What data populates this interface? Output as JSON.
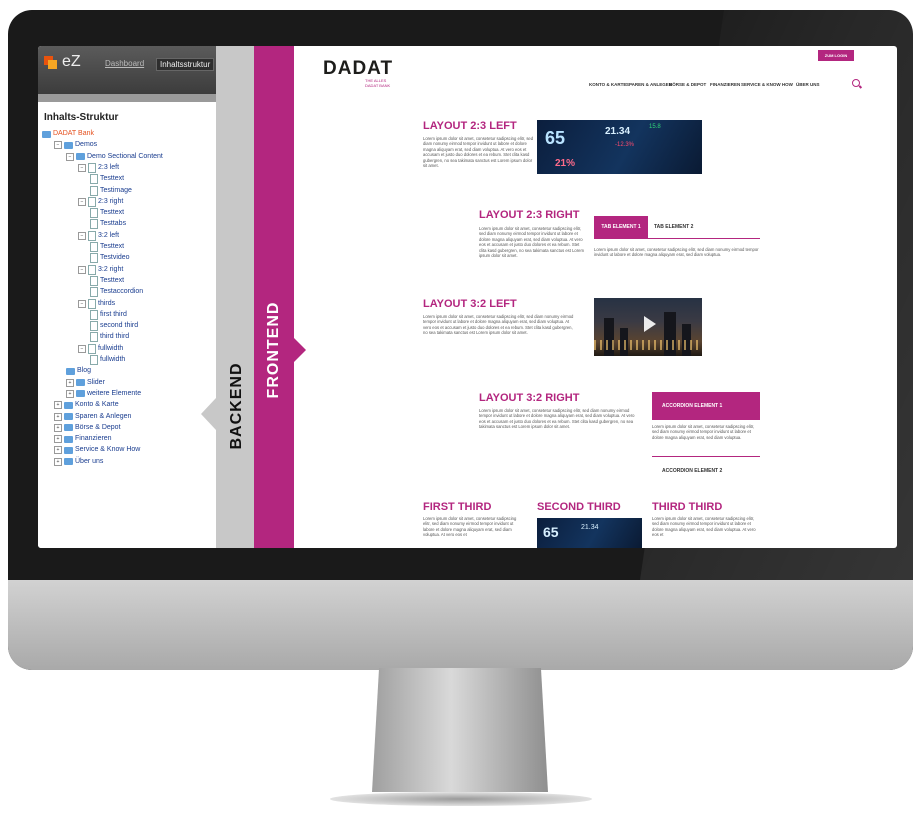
{
  "backend": {
    "logo_text": "eZ",
    "nav": {
      "dashboard": "Dashboard",
      "structure": "Inhaltsstruktur"
    },
    "tree_title": "Inhalts-Struktur",
    "tree": [
      {
        "label": "DADAT Bank",
        "depth": 0,
        "kind": "root",
        "toggle": ""
      },
      {
        "label": "Demos",
        "depth": 1,
        "kind": "folder",
        "toggle": "−"
      },
      {
        "label": "Demo Sectional Content",
        "depth": 2,
        "kind": "folder",
        "toggle": "−"
      },
      {
        "label": "2:3 left",
        "depth": 3,
        "kind": "page",
        "toggle": "−"
      },
      {
        "label": "Testtext",
        "depth": 4,
        "kind": "page",
        "toggle": ""
      },
      {
        "label": "Testimage",
        "depth": 4,
        "kind": "page",
        "toggle": ""
      },
      {
        "label": "2:3 right",
        "depth": 3,
        "kind": "page",
        "toggle": "−"
      },
      {
        "label": "Testtext",
        "depth": 4,
        "kind": "page",
        "toggle": ""
      },
      {
        "label": "Testtabs",
        "depth": 4,
        "kind": "page",
        "toggle": ""
      },
      {
        "label": "3:2 left",
        "depth": 3,
        "kind": "page",
        "toggle": "−"
      },
      {
        "label": "Testtext",
        "depth": 4,
        "kind": "page",
        "toggle": ""
      },
      {
        "label": "Testvideo",
        "depth": 4,
        "kind": "page",
        "toggle": ""
      },
      {
        "label": "3:2 right",
        "depth": 3,
        "kind": "page",
        "toggle": "−"
      },
      {
        "label": "Testtext",
        "depth": 4,
        "kind": "page",
        "toggle": ""
      },
      {
        "label": "Testaccordion",
        "depth": 4,
        "kind": "page",
        "toggle": ""
      },
      {
        "label": "thirds",
        "depth": 3,
        "kind": "page",
        "toggle": "−"
      },
      {
        "label": "first third",
        "depth": 4,
        "kind": "page",
        "toggle": ""
      },
      {
        "label": "second third",
        "depth": 4,
        "kind": "page",
        "toggle": ""
      },
      {
        "label": "third third",
        "depth": 4,
        "kind": "page",
        "toggle": ""
      },
      {
        "label": "fullwidth",
        "depth": 3,
        "kind": "page",
        "toggle": "−"
      },
      {
        "label": "fullwidth",
        "depth": 4,
        "kind": "page",
        "toggle": ""
      },
      {
        "label": "Blog",
        "depth": 2,
        "kind": "folder",
        "toggle": ""
      },
      {
        "label": "Slider",
        "depth": 2,
        "kind": "folder",
        "toggle": "+"
      },
      {
        "label": "weitere Elemente",
        "depth": 2,
        "kind": "folder",
        "toggle": "+"
      },
      {
        "label": "Konto & Karte",
        "depth": 1,
        "kind": "folder",
        "toggle": "+"
      },
      {
        "label": "Sparen & Anlegen",
        "depth": 1,
        "kind": "folder",
        "toggle": "+"
      },
      {
        "label": "Börse & Depot",
        "depth": 1,
        "kind": "folder",
        "toggle": "+"
      },
      {
        "label": "Finanzieren",
        "depth": 1,
        "kind": "folder",
        "toggle": "+"
      },
      {
        "label": "Service & Know How",
        "depth": 1,
        "kind": "folder",
        "toggle": "+"
      },
      {
        "label": "Über uns",
        "depth": 1,
        "kind": "folder",
        "toggle": "+"
      }
    ]
  },
  "labels": {
    "backend": "BACKEND",
    "frontend": "FRONTEND"
  },
  "frontend": {
    "logo": "DADAT",
    "logo_tagline": "THE ALLES\nDADAT BANK",
    "login": "ZUM LOGIN",
    "nav": [
      "KONTO & KARTE",
      "SPAREN & ANLEGEN",
      "BÖRSE & DEPOT",
      "FINANZIEREN",
      "SERVICE & KNOW HOW",
      "ÜBER UNS"
    ],
    "sections": {
      "l23": {
        "title": "LAYOUT 2:3 LEFT",
        "body": "Lorem ipsum dolor sit amet, consetetur sadipscing elitr, sed diam nonumy eirmod tempor invidunt ut labore et dolore magna aliquyam erat, sed diam voluptua. At vero eos et accusam et justo duo dolores et ea rebum. Stet clita kasd gubergren, no sea takimata sanctus est Lorem ipsum dolor sit amet."
      },
      "r23": {
        "title": "LAYOUT 2:3 RIGHT",
        "body": "Lorem ipsum dolor sit amet, consetetur sadipscing elitr, sed diam nonumy eirmod tempor invidunt ut labore et dolore magna aliquyam erat, sed diam voluptua. At vero eos et accusam et justo duo dolores et ea rebum. Stet clita kasd gubergren, no sea takimata sanctus est Lorem ipsum dolor sit amet.",
        "tab1": "TAB ELEMENT 1",
        "tab2": "TAB ELEMENT 2",
        "tab_body": "Lorem ipsum dolor sit amet, consetetur sadipscing elitr, sed diam nonumy eirmod tempor invidunt ut labore et dolore magna aliquyam erat, sed diam voluptua."
      },
      "l32": {
        "title": "LAYOUT 3:2 LEFT",
        "body": "Lorem ipsum dolor sit amet, consetetur sadipscing elitr, sed diam nonumy eirmod tempor invidunt ut labore et dolore magna aliquyam erat, sed diam voluptua. At vero eos et accusam et justo duo dolores et ea rebum. Stet clita kasd gubergren, no sea takimata sanctus est Lorem ipsum dolor sit amet."
      },
      "r32": {
        "title": "LAYOUT 3:2 RIGHT",
        "body": "Lorem ipsum dolor sit amet, consetetur sadipscing elitr, sed diam nonumy eirmod tempor invidunt ut labore et dolore magna aliquyam erat, sed diam voluptua. At vero eos et accusam et justo duo dolores et ea rebum. Stet clita kasd gubergren, no sea takimata sanctus est Lorem ipsum dolor sit amet.",
        "acc1": "ACCORDION ELEMENT 1",
        "acc1_body": "Lorem ipsum dolor sit amet, consetetur sadipscing elitr, sed diam nonumy eirmod tempor invidunt ut labore et dolore magna aliquyam erat, sed diam voluptua.",
        "acc2": "ACCORDION ELEMENT 2"
      },
      "thirds": [
        {
          "title": "FIRST THIRD",
          "body": "Lorem ipsum dolor sit amet, consetetur sadipscing elitr, sed diam nonumy eirmod tempor invidunt ut labore et dolore magna aliquyam erat, sed diam voluptua. At vero eos et"
        },
        {
          "title": "SECOND THIRD"
        },
        {
          "title": "THIRD THIRD",
          "body": "Lorem ipsum dolor sit amet, consetetur sadipscing elitr, sed diam nonumy eirmod tempor invidunt ut labore et dolore magna aliquyam erat, sed diam voluptua. At vero eos et"
        }
      ]
    },
    "ticker": {
      "big": "65",
      "mid": "21.34",
      "small": "15.8",
      "pct": "-12.3%",
      "pct2": "21%"
    }
  },
  "icons": [
    "ez-logo-icon",
    "folder-icon",
    "page-icon",
    "expand-icon",
    "search-icon",
    "play-icon"
  ],
  "colors": {
    "accent": "#b3267f",
    "backend_tree_link": "#1a3d8f",
    "root_link": "#e5501e"
  }
}
